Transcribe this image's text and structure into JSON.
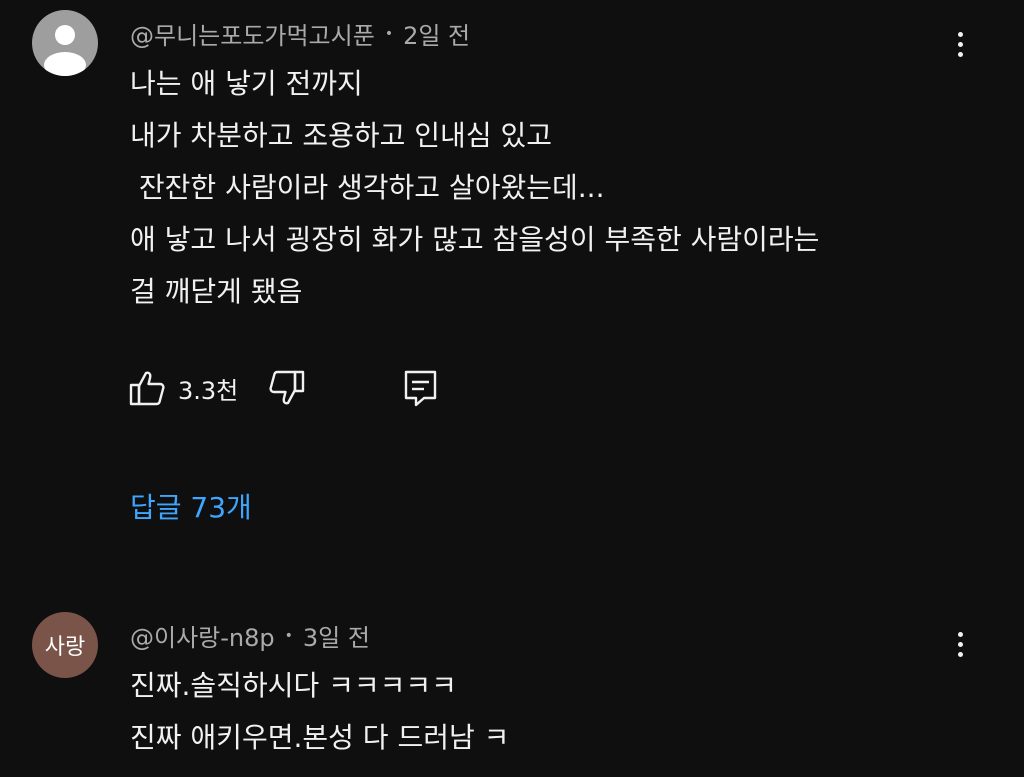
{
  "comments": [
    {
      "author": "@무니는포도가먹고시푼",
      "separator": "•",
      "time": "2일 전",
      "avatar": {
        "type": "default-person-icon",
        "color": "#9e9e9e"
      },
      "lines": [
        "나는 애 낳기 전까지",
        "내가 차분하고 조용하고 인내심 있고",
        " 잔잔한 사람이라 생각하고 살아왔는데...",
        "애 낳고 나서 굉장히 화가 많고 참을성이 부족한 사람이라는",
        "걸 깨닫게 됐음"
      ],
      "like_count": "3.3천",
      "replies_label": "답글 73개"
    },
    {
      "author": "@이사랑-n8p",
      "separator": "•",
      "time": "3일 전",
      "avatar": {
        "type": "text",
        "text": "사랑",
        "color": "#7a5448"
      },
      "lines": [
        "진짜.솔직하시다 ㅋㅋㅋㅋㅋ",
        "진짜 애키우면.본성 다 드러남 ㅋ"
      ]
    }
  ],
  "colors": {
    "background": "#0f0f0f",
    "text": "#f1f1f1",
    "meta_text": "#aaaaaa",
    "link": "#3ea6ff"
  }
}
